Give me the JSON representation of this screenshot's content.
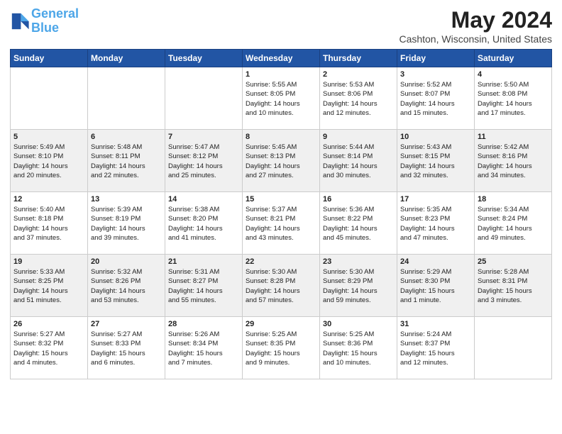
{
  "header": {
    "logo_line1": "General",
    "logo_line2": "Blue",
    "month_year": "May 2024",
    "location": "Cashton, Wisconsin, United States"
  },
  "weekdays": [
    "Sunday",
    "Monday",
    "Tuesday",
    "Wednesday",
    "Thursday",
    "Friday",
    "Saturday"
  ],
  "weeks": [
    [
      {
        "day": "",
        "info": ""
      },
      {
        "day": "",
        "info": ""
      },
      {
        "day": "",
        "info": ""
      },
      {
        "day": "1",
        "info": "Sunrise: 5:55 AM\nSunset: 8:05 PM\nDaylight: 14 hours\nand 10 minutes."
      },
      {
        "day": "2",
        "info": "Sunrise: 5:53 AM\nSunset: 8:06 PM\nDaylight: 14 hours\nand 12 minutes."
      },
      {
        "day": "3",
        "info": "Sunrise: 5:52 AM\nSunset: 8:07 PM\nDaylight: 14 hours\nand 15 minutes."
      },
      {
        "day": "4",
        "info": "Sunrise: 5:50 AM\nSunset: 8:08 PM\nDaylight: 14 hours\nand 17 minutes."
      }
    ],
    [
      {
        "day": "5",
        "info": "Sunrise: 5:49 AM\nSunset: 8:10 PM\nDaylight: 14 hours\nand 20 minutes."
      },
      {
        "day": "6",
        "info": "Sunrise: 5:48 AM\nSunset: 8:11 PM\nDaylight: 14 hours\nand 22 minutes."
      },
      {
        "day": "7",
        "info": "Sunrise: 5:47 AM\nSunset: 8:12 PM\nDaylight: 14 hours\nand 25 minutes."
      },
      {
        "day": "8",
        "info": "Sunrise: 5:45 AM\nSunset: 8:13 PM\nDaylight: 14 hours\nand 27 minutes."
      },
      {
        "day": "9",
        "info": "Sunrise: 5:44 AM\nSunset: 8:14 PM\nDaylight: 14 hours\nand 30 minutes."
      },
      {
        "day": "10",
        "info": "Sunrise: 5:43 AM\nSunset: 8:15 PM\nDaylight: 14 hours\nand 32 minutes."
      },
      {
        "day": "11",
        "info": "Sunrise: 5:42 AM\nSunset: 8:16 PM\nDaylight: 14 hours\nand 34 minutes."
      }
    ],
    [
      {
        "day": "12",
        "info": "Sunrise: 5:40 AM\nSunset: 8:18 PM\nDaylight: 14 hours\nand 37 minutes."
      },
      {
        "day": "13",
        "info": "Sunrise: 5:39 AM\nSunset: 8:19 PM\nDaylight: 14 hours\nand 39 minutes."
      },
      {
        "day": "14",
        "info": "Sunrise: 5:38 AM\nSunset: 8:20 PM\nDaylight: 14 hours\nand 41 minutes."
      },
      {
        "day": "15",
        "info": "Sunrise: 5:37 AM\nSunset: 8:21 PM\nDaylight: 14 hours\nand 43 minutes."
      },
      {
        "day": "16",
        "info": "Sunrise: 5:36 AM\nSunset: 8:22 PM\nDaylight: 14 hours\nand 45 minutes."
      },
      {
        "day": "17",
        "info": "Sunrise: 5:35 AM\nSunset: 8:23 PM\nDaylight: 14 hours\nand 47 minutes."
      },
      {
        "day": "18",
        "info": "Sunrise: 5:34 AM\nSunset: 8:24 PM\nDaylight: 14 hours\nand 49 minutes."
      }
    ],
    [
      {
        "day": "19",
        "info": "Sunrise: 5:33 AM\nSunset: 8:25 PM\nDaylight: 14 hours\nand 51 minutes."
      },
      {
        "day": "20",
        "info": "Sunrise: 5:32 AM\nSunset: 8:26 PM\nDaylight: 14 hours\nand 53 minutes."
      },
      {
        "day": "21",
        "info": "Sunrise: 5:31 AM\nSunset: 8:27 PM\nDaylight: 14 hours\nand 55 minutes."
      },
      {
        "day": "22",
        "info": "Sunrise: 5:30 AM\nSunset: 8:28 PM\nDaylight: 14 hours\nand 57 minutes."
      },
      {
        "day": "23",
        "info": "Sunrise: 5:30 AM\nSunset: 8:29 PM\nDaylight: 14 hours\nand 59 minutes."
      },
      {
        "day": "24",
        "info": "Sunrise: 5:29 AM\nSunset: 8:30 PM\nDaylight: 15 hours\nand 1 minute."
      },
      {
        "day": "25",
        "info": "Sunrise: 5:28 AM\nSunset: 8:31 PM\nDaylight: 15 hours\nand 3 minutes."
      }
    ],
    [
      {
        "day": "26",
        "info": "Sunrise: 5:27 AM\nSunset: 8:32 PM\nDaylight: 15 hours\nand 4 minutes."
      },
      {
        "day": "27",
        "info": "Sunrise: 5:27 AM\nSunset: 8:33 PM\nDaylight: 15 hours\nand 6 minutes."
      },
      {
        "day": "28",
        "info": "Sunrise: 5:26 AM\nSunset: 8:34 PM\nDaylight: 15 hours\nand 7 minutes."
      },
      {
        "day": "29",
        "info": "Sunrise: 5:25 AM\nSunset: 8:35 PM\nDaylight: 15 hours\nand 9 minutes."
      },
      {
        "day": "30",
        "info": "Sunrise: 5:25 AM\nSunset: 8:36 PM\nDaylight: 15 hours\nand 10 minutes."
      },
      {
        "day": "31",
        "info": "Sunrise: 5:24 AM\nSunset: 8:37 PM\nDaylight: 15 hours\nand 12 minutes."
      },
      {
        "day": "",
        "info": ""
      }
    ]
  ]
}
